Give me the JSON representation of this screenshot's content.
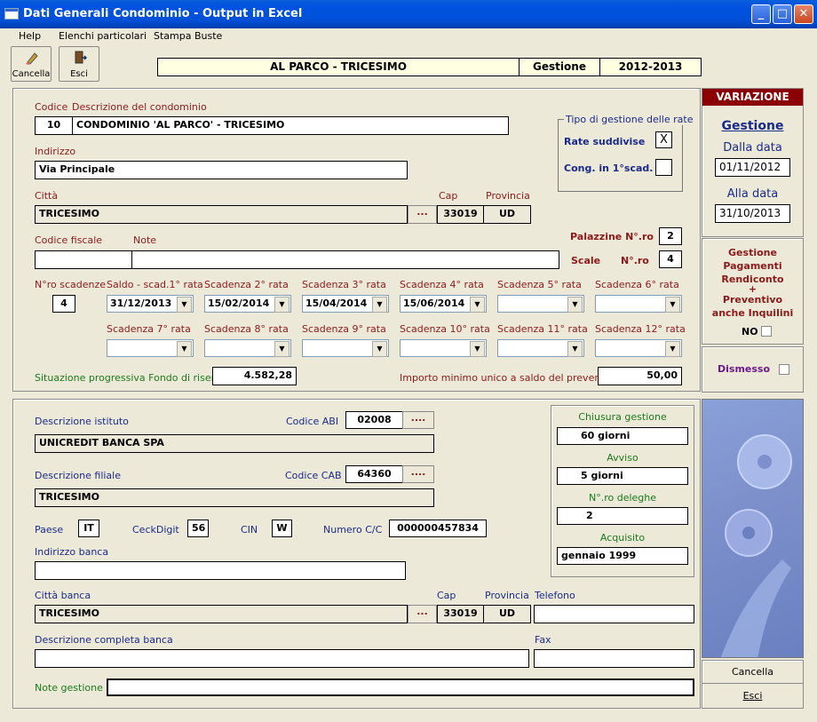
{
  "window": {
    "title": "Dati Generali Condominio - Output in Excel",
    "min": "_",
    "max": "□",
    "close": "✕"
  },
  "menu": [
    "Help",
    "Elenchi particolari",
    "Stampa Buste"
  ],
  "toolbar": {
    "cancel_label": "Cancella",
    "exit_label": "Esci"
  },
  "header": {
    "condominio": "AL PARCO - TRICESIMO",
    "gestione_label": "Gestione",
    "gestione_value": "2012-2013"
  },
  "main": {
    "codice_label": "Codice",
    "descrizione_label": "Descrizione del condominio",
    "codice": "10",
    "descrizione": "CONDOMINIO 'AL PARCO' - TRICESIMO",
    "indirizzo_label": "Indirizzo",
    "indirizzo": "Via Principale",
    "citta_label": "Città",
    "citta": "TRICESIMO",
    "cap_label": "Cap",
    "cap": "33019",
    "provincia_label": "Provincia",
    "provincia": "UD",
    "dots": "...",
    "cf_label": "Codice fiscale",
    "cf": "",
    "note_label": "Note",
    "note": "",
    "tipo_group": "Tipo di gestione delle rate",
    "rate_suddivise_label": "Rate suddivise",
    "rate_suddivise_check": "X",
    "cong_label": "Cong. in 1°scad.",
    "cong_check": "",
    "palazzine_label": "Palazzine N°.ro",
    "palazzine": "2",
    "scale_label": "Scale",
    "scale_nro_label": "N°.ro",
    "scale": "4",
    "nro_scadenze_label": "N°ro scadenze",
    "nro_scadenze": "4",
    "scadenze_labels_row1": [
      "Saldo - scad.1° rata",
      "Scadenza 2° rata",
      "Scadenza 3° rata",
      "Scadenza 4° rata",
      "Scadenza 5° rata",
      "Scadenza 6° rata"
    ],
    "scadenze_values_row1": [
      "31/12/2013",
      "15/02/2014",
      "15/04/2014",
      "15/06/2014",
      "",
      ""
    ],
    "scadenze_labels_row2": [
      "Scadenza 7° rata",
      "Scadenza 8° rata",
      "Scadenza 9° rata",
      "Scadenza 10° rata",
      "Scadenza 11° rata",
      "Scadenza 12° rata"
    ],
    "scadenze_values_row2": [
      "",
      "",
      "",
      "",
      "",
      ""
    ],
    "fondo_label": "Situazione progressiva Fondo di riserva",
    "fondo": "4.582,28",
    "importo_label": "Importo minimo unico a saldo del preventivo",
    "importo": "50,00"
  },
  "side": {
    "variazione": "VARIAZIONE",
    "gestione": "Gestione",
    "dalla_label": "Dalla data",
    "dalla": "01/11/2012",
    "alla_label": "Alla data",
    "alla": "31/10/2013",
    "gest_pag_lines": [
      "Gestione",
      "Pagamenti",
      "Rendiconto",
      "+",
      "Preventivo",
      "anche Inquilini"
    ],
    "no_label": "NO",
    "dismesso_label": "Dismesso",
    "cancella": "Cancella",
    "esci": "Esci"
  },
  "bank": {
    "istituto_label": "Descrizione istituto",
    "istituto": "UNICREDIT BANCA SPA",
    "abi_label": "Codice ABI",
    "abi": "02008",
    "abi_dots": "....",
    "filiale_label": "Descrizione filiale",
    "filiale": "TRICESIMO",
    "cab_label": "Codice CAB",
    "cab": "64360",
    "cab_dots": "....",
    "paese_label": "Paese",
    "paese": "IT",
    "checkdigit_label": "CeckDigit",
    "checkdigit": "56",
    "cin_label": "CIN",
    "cin": "W",
    "numero_cc_label": "Numero C/C",
    "numero_cc": "000000457834",
    "indirizzo_label": "Indirizzo banca",
    "indirizzo": "",
    "citta_label": "Città banca",
    "citta": "TRICESIMO",
    "cap_label": "Cap",
    "cap": "33019",
    "provincia_label": "Provincia",
    "provincia": "UD",
    "telefono_label": "Telefono",
    "telefono": "",
    "desc_completa_label": "Descrizione completa banca",
    "desc_completa": "",
    "fax_label": "Fax",
    "fax": "",
    "note_label": "Note gestione",
    "note": "",
    "chiusura_label": "Chiusura gestione",
    "chiusura": "60 giorni",
    "avviso_label": "Avviso",
    "avviso": "5 giorni",
    "deleghe_label": "N°.ro deleghe",
    "deleghe": "2",
    "acquisito_label": "Acquisito",
    "acquisito": "gennaio 1999"
  }
}
